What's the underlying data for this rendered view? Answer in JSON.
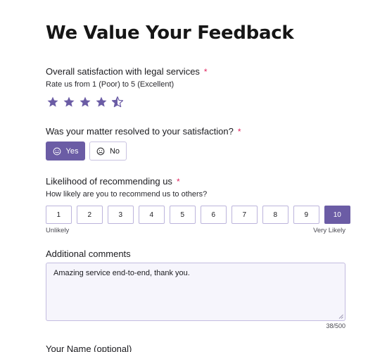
{
  "form": {
    "title": "We Value Your Feedback",
    "satisfaction": {
      "label": "Overall satisfaction with legal services",
      "required_mark": "*",
      "subtitle": "Rate us from 1 (Poor) to 5 (Excellent)",
      "rating": 4.5,
      "max_rating": 5
    },
    "resolved": {
      "label": "Was your matter resolved to your satisfaction?",
      "required_mark": "*",
      "yes_label": "Yes",
      "no_label": "No",
      "selected": "Yes"
    },
    "recommend": {
      "label": "Likelihood of recommending us",
      "required_mark": "*",
      "subtitle": "How likely are you to recommend us to others?",
      "options": [
        "1",
        "2",
        "3",
        "4",
        "5",
        "6",
        "7",
        "8",
        "9",
        "10"
      ],
      "selected": "10",
      "low_label": "Unlikely",
      "high_label": "Very Likely"
    },
    "comments": {
      "label": "Additional comments",
      "value": "Amazing service end-to-end, thank you.",
      "counter": "38/500"
    },
    "name": {
      "label": "Your Name (optional)"
    }
  },
  "colors": {
    "accent": "#6b5ca5",
    "required": "#e0245e",
    "border": "#c3bce0"
  }
}
